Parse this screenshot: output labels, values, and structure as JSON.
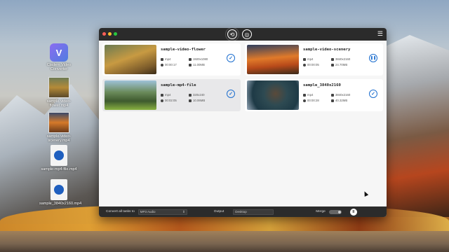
{
  "desktop": {
    "icons": [
      {
        "label": "Cisdem Video Converter"
      },
      {
        "label": "sample-video-flower.mp4"
      },
      {
        "label": "sample-video-scenery.mp4"
      },
      {
        "label": "sample-mp4-file.mp4"
      },
      {
        "label": "sample_3840x2160.mp4"
      }
    ]
  },
  "titlebar": {
    "convert_tab_icon": "convert-icon",
    "rip_tab_icon": "dvd-rip-icon",
    "right_icon": "menu-icon"
  },
  "videos": [
    {
      "name": "sample-video-flower",
      "format": "mp4",
      "resolution": "1920x1080",
      "duration": "00:00:17",
      "size": "11.00MB",
      "status": "done",
      "status_glyph": "✓"
    },
    {
      "name": "sample-video-scenery",
      "format": "mp4",
      "resolution": "3840x2160",
      "duration": "00:00:05",
      "size": "24.70MB",
      "status": "paused",
      "status_glyph": "❚❚"
    },
    {
      "name": "sample-mp4-file",
      "format": "mp4",
      "resolution": "320x240",
      "duration": "00:02:05",
      "size": "10.06MB",
      "status": "done",
      "status_glyph": "✓"
    },
    {
      "name": "sample_3840x2160",
      "format": "mp4",
      "resolution": "3840x2160",
      "duration": "00:00:28",
      "size": "40.32MB",
      "status": "done",
      "status_glyph": "✓"
    }
  ],
  "footer": {
    "convert_all_label": "Convert all tasks to",
    "format_value": "MP3 Audio",
    "output_label": "Output",
    "output_value": "Desktop",
    "merge_label": "Merge",
    "start_glyph": "II"
  },
  "colors": {
    "accent": "#1e6fcf",
    "titlebar": "#2b2b2b",
    "window_bg": "#f6f6f6"
  }
}
